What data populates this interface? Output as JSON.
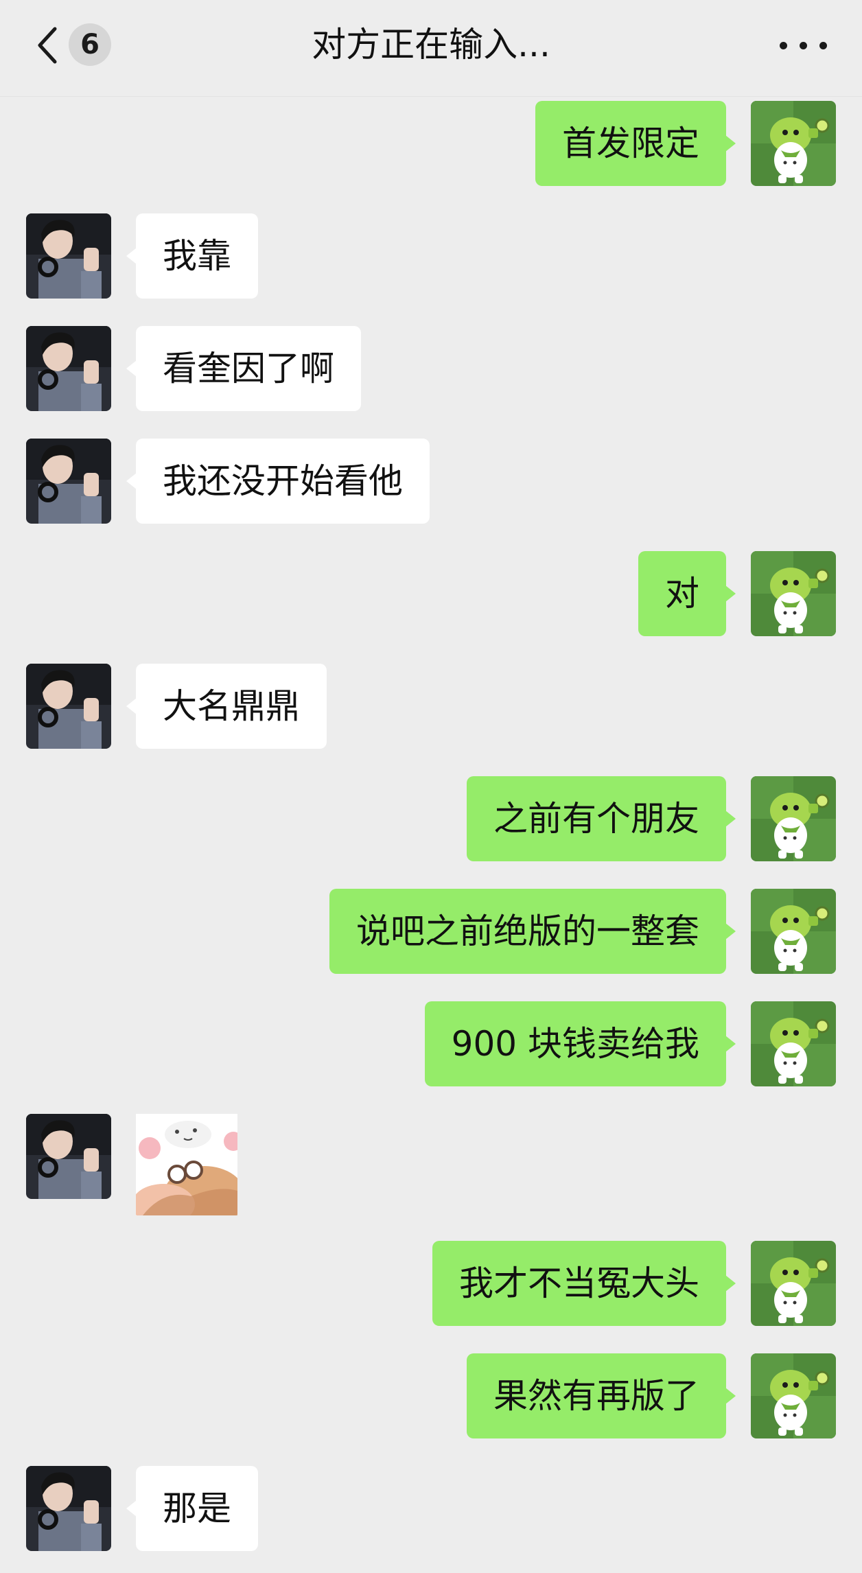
{
  "header": {
    "title": "对方正在输入...",
    "unread_count": "6",
    "back_icon": "chevron-left-icon",
    "more_icon": "more-dots-icon"
  },
  "colors": {
    "background": "#ededed",
    "self_bubble": "#95ec69",
    "other_bubble": "#ffffff"
  },
  "messages": [
    {
      "side": "right",
      "type": "text",
      "text": "首发限定"
    },
    {
      "side": "left",
      "type": "text",
      "text": "我靠"
    },
    {
      "side": "left",
      "type": "text",
      "text": "看奎因了啊"
    },
    {
      "side": "left",
      "type": "text",
      "text": "我还没开始看他"
    },
    {
      "side": "right",
      "type": "text",
      "text": "对"
    },
    {
      "side": "left",
      "type": "text",
      "text": "大名鼎鼎"
    },
    {
      "side": "right",
      "type": "text",
      "text": "之前有个朋友"
    },
    {
      "side": "right",
      "type": "text",
      "text": "说吧之前绝版的一整套"
    },
    {
      "side": "right",
      "type": "text",
      "text": "900 块钱卖给我"
    },
    {
      "side": "left",
      "type": "sticker",
      "icon": "sticker-image"
    },
    {
      "side": "right",
      "type": "text",
      "text": "我才不当冤大头"
    },
    {
      "side": "right",
      "type": "text",
      "text": "果然有再版了"
    },
    {
      "side": "left",
      "type": "text",
      "text": "那是"
    }
  ]
}
